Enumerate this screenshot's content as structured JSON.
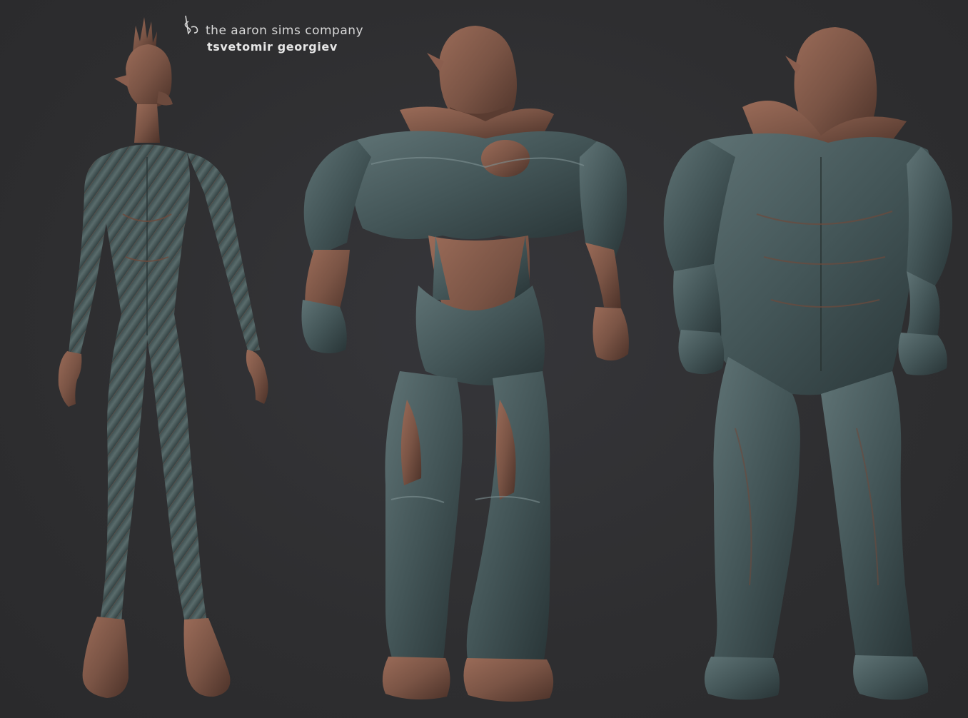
{
  "watermark": {
    "logo_letters": "AS",
    "company": "the aaron sims company",
    "artist": "tsvetomir georgiev"
  },
  "figures": [
    {
      "name": "slender-alien-figure"
    },
    {
      "name": "armored-brute-figure"
    },
    {
      "name": "muscular-brute-figure"
    }
  ],
  "colors": {
    "background": "#2f2f31",
    "skin": "#7a5445",
    "armor": "#3f5052",
    "text": "#d8d8d8"
  }
}
